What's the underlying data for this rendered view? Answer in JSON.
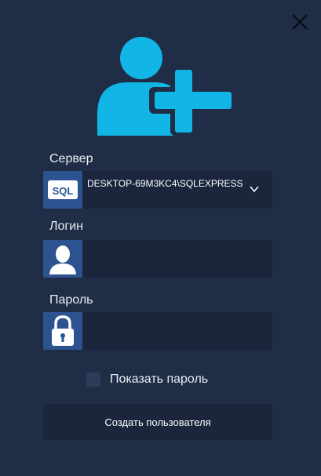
{
  "server": {
    "label": "Сервер",
    "icon_text": "SQL",
    "value": "DESKTOP-69M3KC4\\SQLEXPRESS",
    "icon": "sql-icon"
  },
  "login": {
    "label": "Логин",
    "value": "",
    "icon": "user-icon"
  },
  "password": {
    "label": "Пароль",
    "value": "",
    "icon": "lock-icon"
  },
  "show_password": {
    "label": "Показать пароль",
    "checked": false
  },
  "create_button": {
    "label": "Создать пользователя"
  },
  "icons": {
    "header": "add-user-icon",
    "close": "close-icon"
  },
  "colors": {
    "background": "#1f2d47",
    "field_bg": "#1b263d",
    "icon_box": "#2c5290",
    "accent": "#11b5e6"
  }
}
